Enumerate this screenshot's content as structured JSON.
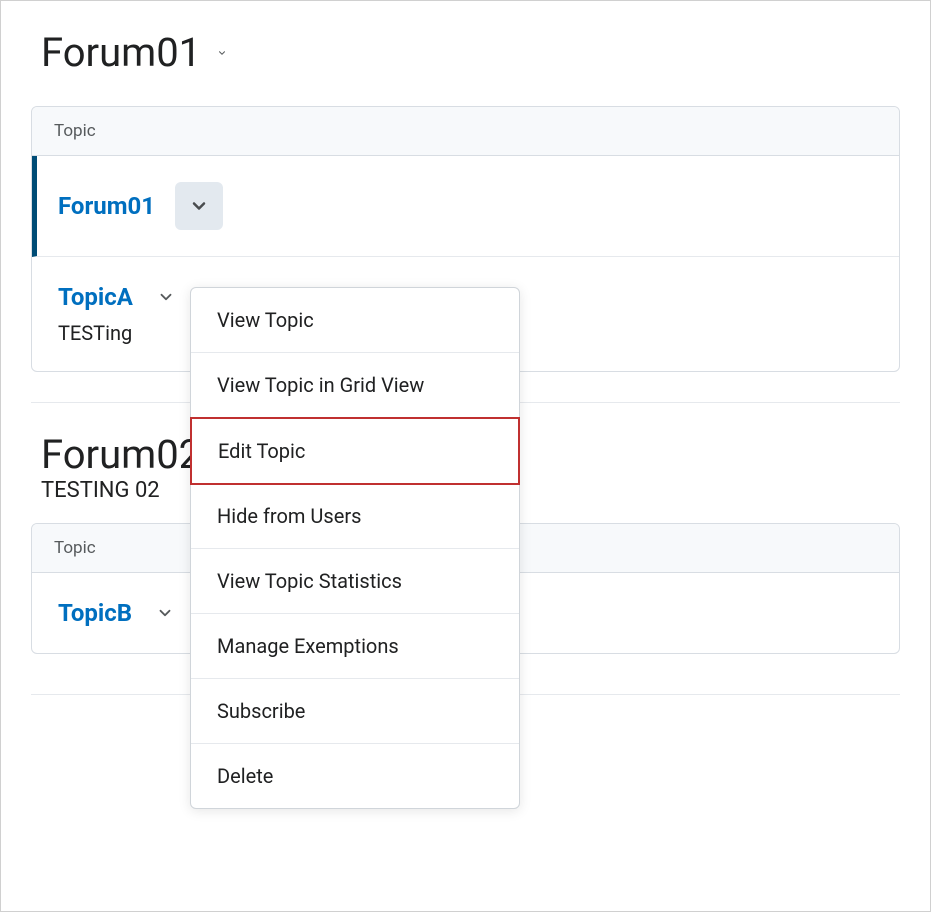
{
  "forums": [
    {
      "title": "Forum01",
      "table_header": "Topic",
      "rows": [
        {
          "name": "Forum01",
          "selected": true
        },
        {
          "name": "TopicA",
          "description": "TESTing"
        }
      ]
    },
    {
      "title": "Forum02",
      "subtitle": "TESTING 02",
      "table_header": "Topic",
      "rows": [
        {
          "name": "TopicB"
        }
      ]
    }
  ],
  "dropdown": {
    "items": [
      "View Topic",
      "View Topic in Grid View",
      "Edit Topic",
      "Hide from Users",
      "View Topic Statistics",
      "Manage Exemptions",
      "Subscribe",
      "Delete"
    ],
    "highlighted_index": 2
  }
}
